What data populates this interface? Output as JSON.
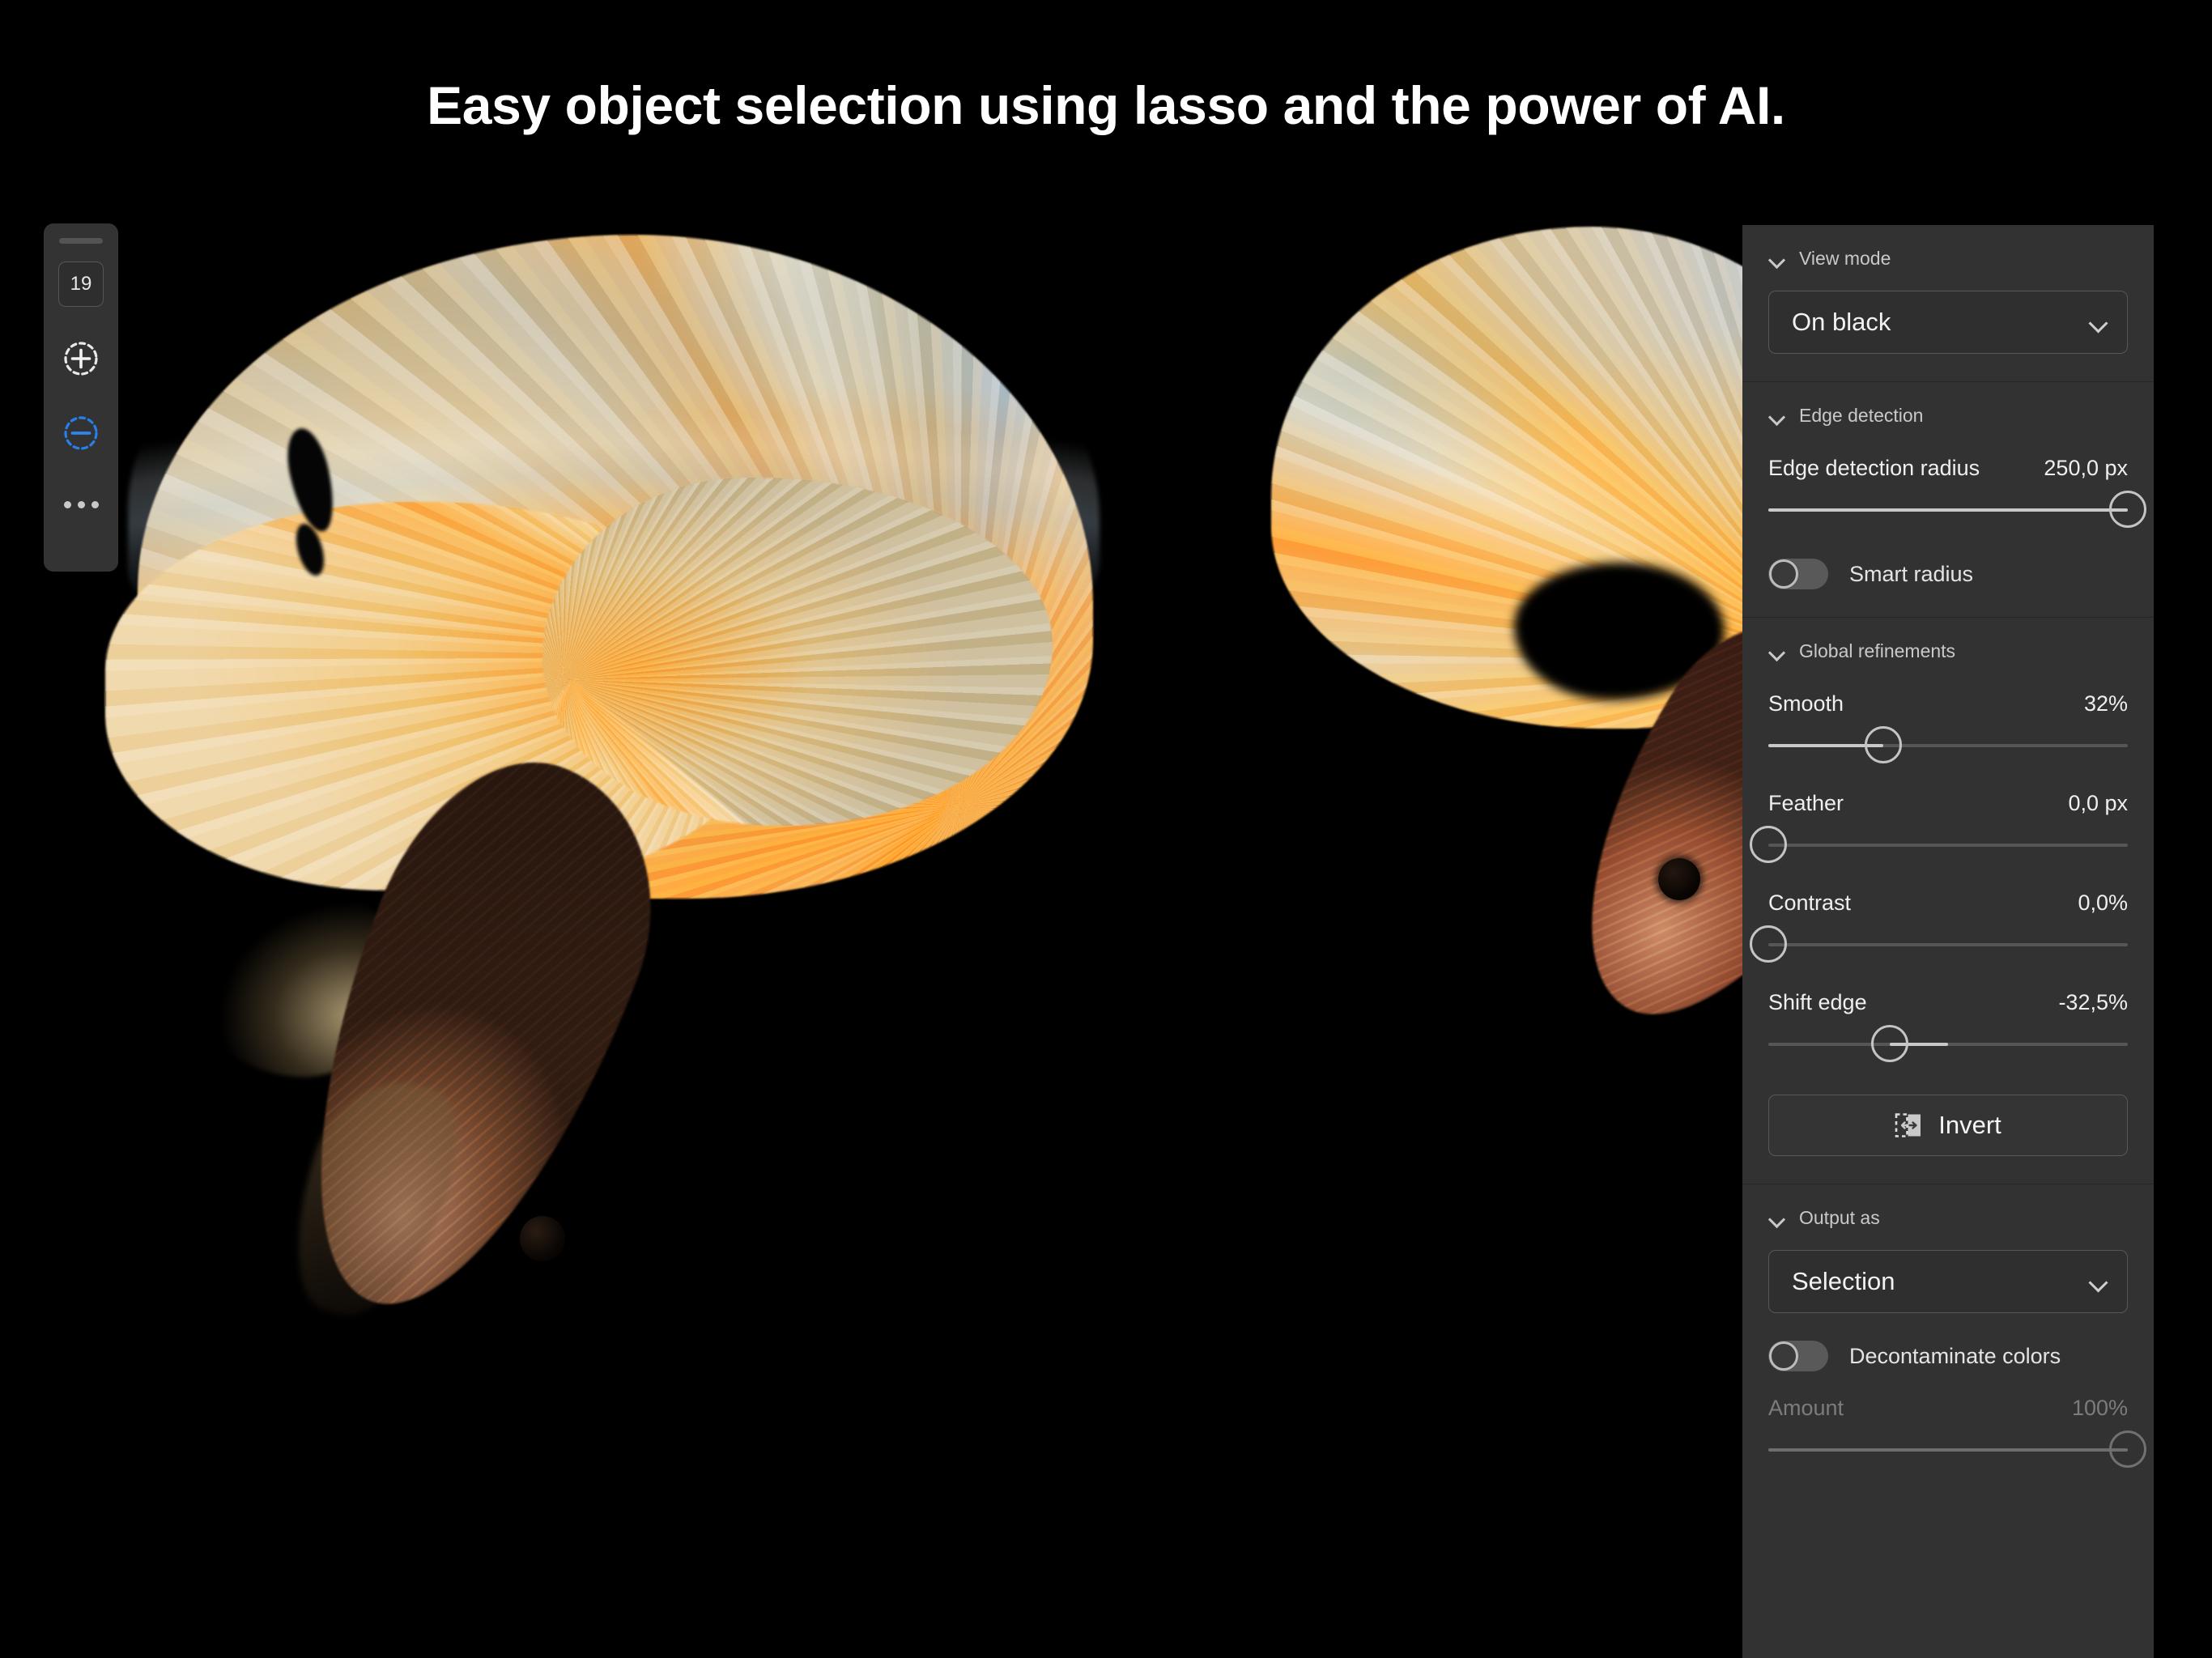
{
  "headline": "Easy object selection using lasso and the power of AI.",
  "toolbar": {
    "grip_name": "drag-handle",
    "brush_size": "19",
    "add_icon": "add-to-selection-icon",
    "subtract_icon": "subtract-from-selection-icon",
    "more_label": "…"
  },
  "panel": {
    "sections": [
      {
        "title": "View mode",
        "dropdown": {
          "label": "On black",
          "chevron": "chevron-down-icon"
        }
      },
      {
        "title": "Edge detection",
        "radius": {
          "label": "Edge detection radius",
          "value": "250,0 px",
          "percent": 100
        },
        "smart_radius": {
          "label": "Smart radius",
          "on": false
        }
      },
      {
        "title": "Global refinements",
        "sliders": [
          {
            "label": "Smooth",
            "value": "32%",
            "percent": 32,
            "bipolar": false
          },
          {
            "label": "Feather",
            "value": "0,0 px",
            "percent": 0,
            "bipolar": false
          },
          {
            "label": "Contrast",
            "value": "0,0%",
            "percent": 0,
            "bipolar": false
          },
          {
            "label": "Shift edge",
            "value": "-32,5%",
            "percent": 33.75,
            "bipolar": true
          }
        ],
        "invert": {
          "label": "Invert",
          "icon": "invert-selection-icon"
        }
      },
      {
        "title": "Output as",
        "dropdown": {
          "label": "Selection",
          "chevron": "chevron-down-icon"
        },
        "decontaminate": {
          "label": "Decontaminate colors",
          "on": false
        },
        "amount": {
          "label": "Amount",
          "value": "100%",
          "percent": 100,
          "disabled": true
        }
      }
    ]
  },
  "colors": {
    "panel_bg": "#323232",
    "accent_blue": "#2680eb",
    "text": "#e8e8e8",
    "text_dim": "#7c7c7c",
    "canvas_bg": "#000000"
  }
}
